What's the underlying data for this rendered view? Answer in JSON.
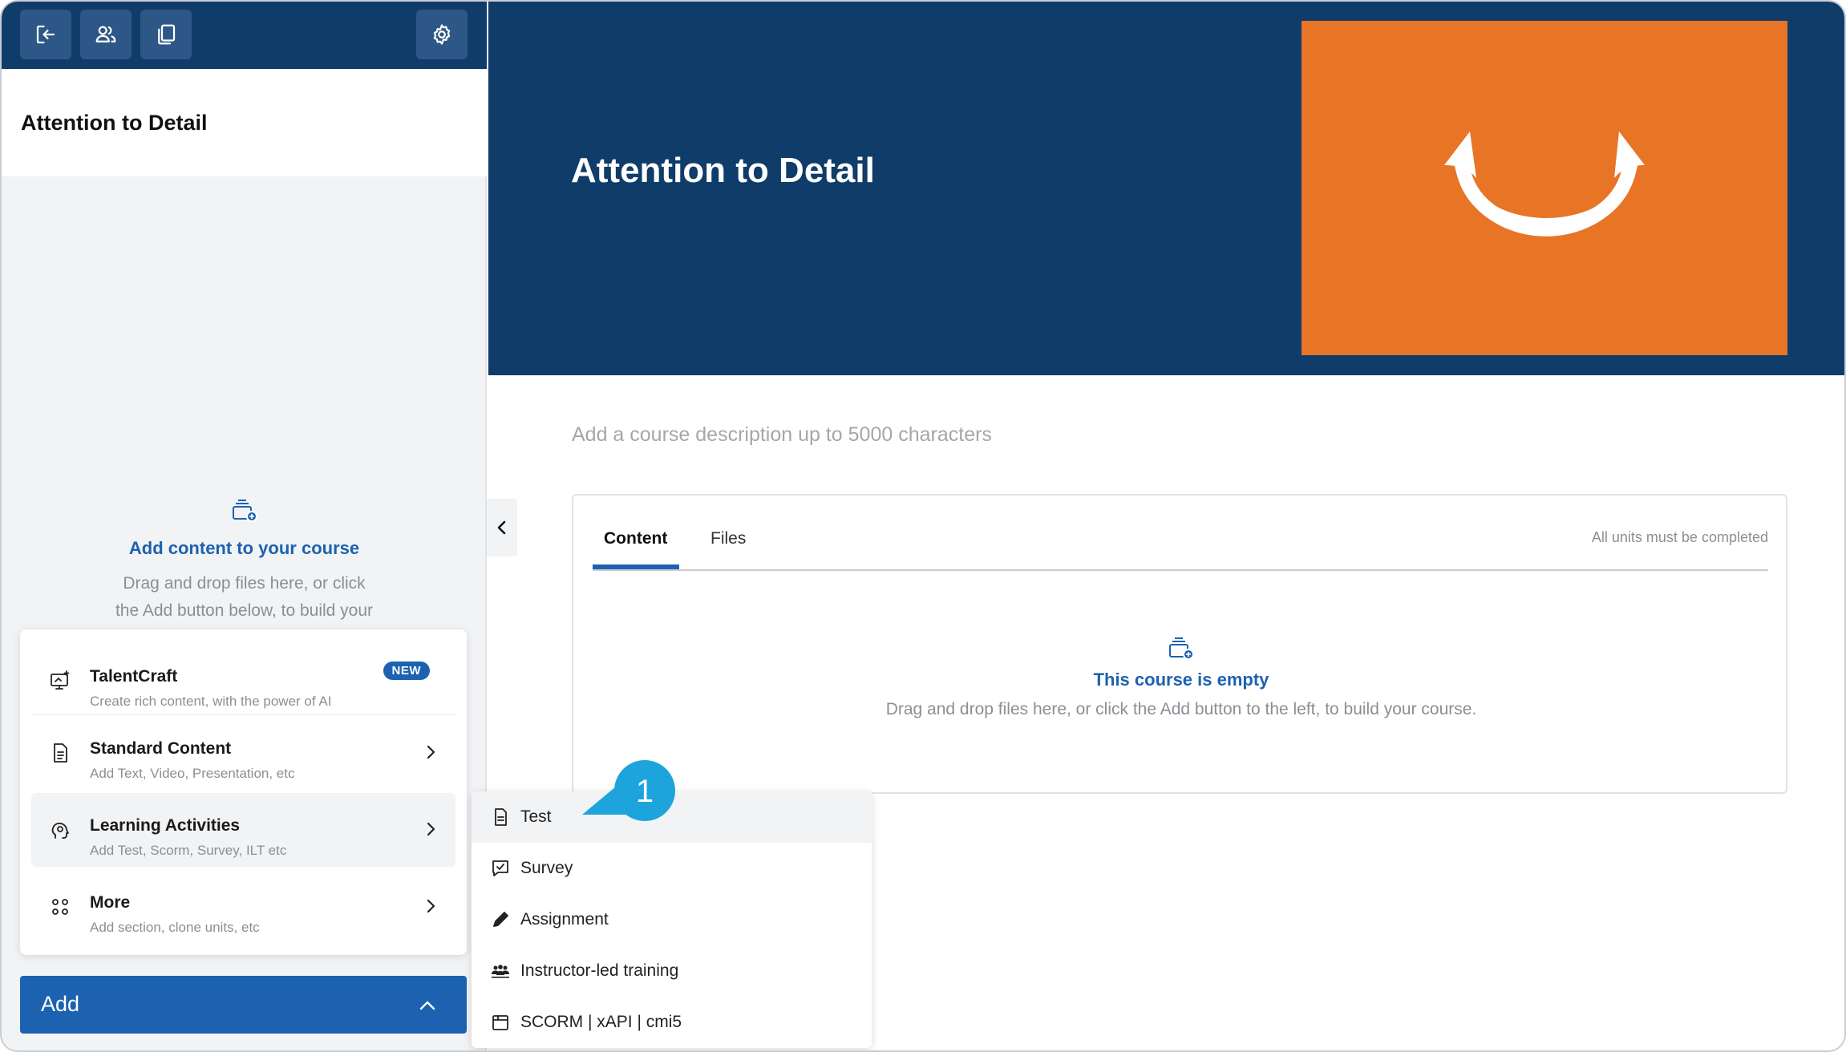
{
  "toolbar": {
    "exit_icon": "exit-icon",
    "users_icon": "users-icon",
    "copy_icon": "copy-icon",
    "settings_icon": "gear-icon"
  },
  "sidebar": {
    "course_title": "Attention to Detail",
    "empty_state": {
      "heading": "Add content to your course",
      "line1": "Drag and drop files here, or click",
      "line2": "the Add button below, to build your"
    },
    "menu": [
      {
        "title": "TalentCraft",
        "desc": "Create rich content, with the power of AI",
        "badge": "NEW",
        "icon": "ai-screen-icon"
      },
      {
        "title": "Standard Content",
        "desc": "Add Text, Video, Presentation, etc",
        "icon": "document-icon"
      },
      {
        "title": "Learning Activities",
        "desc": "Add Test, Scorm, Survey, ILT etc",
        "icon": "activity-head-icon"
      },
      {
        "title": "More",
        "desc": "Add section, clone units, etc",
        "icon": "grid-dots-icon"
      }
    ],
    "add_button": "Add"
  },
  "hero": {
    "title": "Attention to Detail"
  },
  "main": {
    "description_placeholder": "Add a course description up to 5000 characters",
    "tabs": [
      "Content",
      "Files"
    ],
    "completion_rule": "All units must be completed",
    "empty_state": {
      "heading": "This course is empty",
      "text": "Drag and drop files here, or click the Add button to the left, to build your course."
    }
  },
  "submenu": [
    {
      "label": "Test",
      "icon": "test-document-icon"
    },
    {
      "label": "Survey",
      "icon": "survey-check-icon"
    },
    {
      "label": "Assignment",
      "icon": "pencil-icon"
    },
    {
      "label": "Instructor-led training",
      "icon": "group-icon"
    },
    {
      "label": "SCORM | xAPI | cmi5",
      "icon": "package-icon"
    }
  ],
  "callout": {
    "number": "1"
  },
  "colors": {
    "navy": "#0f3c69",
    "accent_blue": "#1c62b0",
    "orange": "#e87526"
  }
}
